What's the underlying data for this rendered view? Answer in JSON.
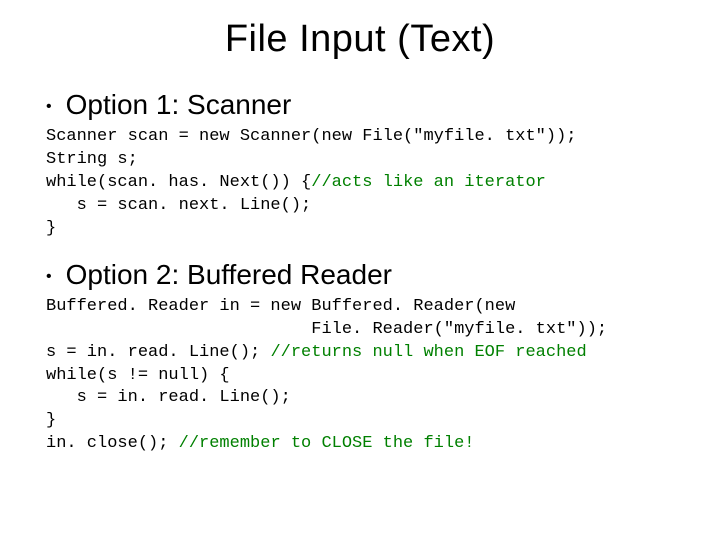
{
  "title": "File Input (Text)",
  "sections": [
    {
      "bullet": "Option 1: Scanner",
      "code": [
        {
          "plain": "Scanner scan = new Scanner(new File(\"myfile. txt\"));",
          "comment": ""
        },
        {
          "plain": "String s;",
          "comment": ""
        },
        {
          "plain": "while(scan. has. Next()) {",
          "comment": "//acts like an iterator"
        },
        {
          "plain": "   s = scan. next. Line();",
          "comment": ""
        },
        {
          "plain": "}",
          "comment": ""
        }
      ]
    },
    {
      "bullet": "Option 2: Buffered Reader",
      "code": [
        {
          "plain": "Buffered. Reader in = new Buffered. Reader(new",
          "comment": ""
        },
        {
          "plain": "                          File. Reader(\"myfile. txt\"));",
          "comment": ""
        },
        {
          "plain": "s = in. read. Line(); ",
          "comment": "//returns null when EOF reached"
        },
        {
          "plain": "while(s != null) {",
          "comment": ""
        },
        {
          "plain": "   s = in. read. Line();",
          "comment": ""
        },
        {
          "plain": "}",
          "comment": ""
        },
        {
          "plain": "in. close(); ",
          "comment": "//remember to CLOSE the file!"
        }
      ]
    }
  ]
}
